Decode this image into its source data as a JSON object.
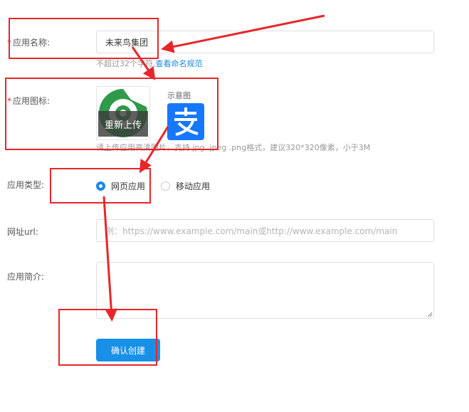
{
  "form": {
    "app_name": {
      "label": "应用名称:",
      "value": "未来鸟集团",
      "hint_text": "不超过32个字符,",
      "hint_link": "查看命名规范"
    },
    "app_icon": {
      "label": "应用图标:",
      "reupload_label": "重新上传",
      "sample_label": "示意图",
      "hint": "请上传应用高清图片，支持.jpg .jpeg .png格式，建议320*320像素，小于3M"
    },
    "app_type": {
      "label": "应用类型:",
      "options": [
        {
          "label": "网页应用",
          "checked": true
        },
        {
          "label": "移动应用",
          "checked": false
        }
      ]
    },
    "url": {
      "label": "网址url:",
      "placeholder": "例：https://www.example.com/main或http://www.example.com/main"
    },
    "description": {
      "label": "应用简介:",
      "value": ""
    },
    "submit_label": "确认创建"
  },
  "colors": {
    "accent": "#1890e8",
    "annotation": "#e8262a",
    "required_mark": "#f5222d",
    "alipay_blue": "#1677ff",
    "logo_green": "#2e9a4a"
  },
  "icons": {
    "uploaded_icon": "green-ring-logo-icon",
    "sample_icon": "alipay-icon"
  }
}
